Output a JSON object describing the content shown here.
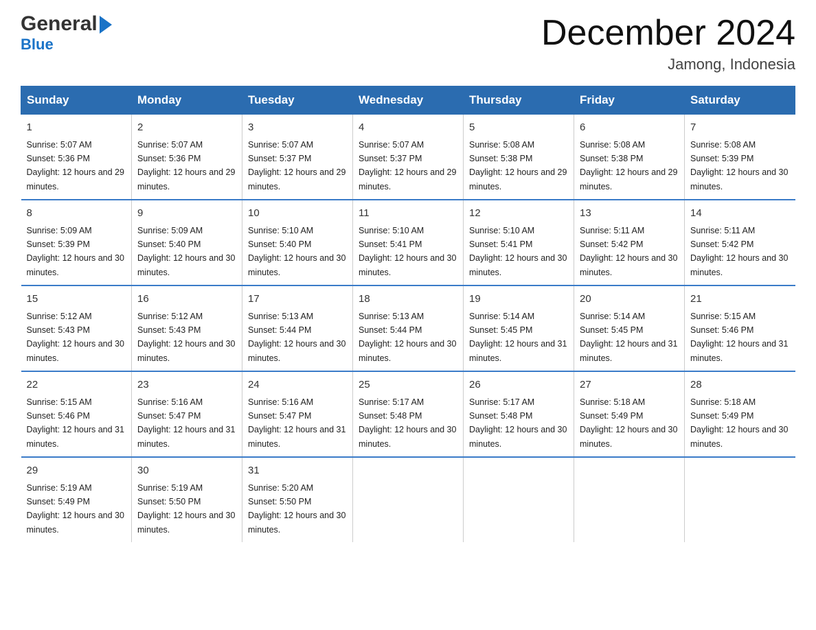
{
  "logo": {
    "general": "General",
    "blue": "Blue",
    "subtitle": "Blue"
  },
  "title": "December 2024",
  "location": "Jamong, Indonesia",
  "days_of_week": [
    "Sunday",
    "Monday",
    "Tuesday",
    "Wednesday",
    "Thursday",
    "Friday",
    "Saturday"
  ],
  "weeks": [
    [
      {
        "day": "1",
        "sunrise": "5:07 AM",
        "sunset": "5:36 PM",
        "daylight": "12 hours and 29 minutes."
      },
      {
        "day": "2",
        "sunrise": "5:07 AM",
        "sunset": "5:36 PM",
        "daylight": "12 hours and 29 minutes."
      },
      {
        "day": "3",
        "sunrise": "5:07 AM",
        "sunset": "5:37 PM",
        "daylight": "12 hours and 29 minutes."
      },
      {
        "day": "4",
        "sunrise": "5:07 AM",
        "sunset": "5:37 PM",
        "daylight": "12 hours and 29 minutes."
      },
      {
        "day": "5",
        "sunrise": "5:08 AM",
        "sunset": "5:38 PM",
        "daylight": "12 hours and 29 minutes."
      },
      {
        "day": "6",
        "sunrise": "5:08 AM",
        "sunset": "5:38 PM",
        "daylight": "12 hours and 29 minutes."
      },
      {
        "day": "7",
        "sunrise": "5:08 AM",
        "sunset": "5:39 PM",
        "daylight": "12 hours and 30 minutes."
      }
    ],
    [
      {
        "day": "8",
        "sunrise": "5:09 AM",
        "sunset": "5:39 PM",
        "daylight": "12 hours and 30 minutes."
      },
      {
        "day": "9",
        "sunrise": "5:09 AM",
        "sunset": "5:40 PM",
        "daylight": "12 hours and 30 minutes."
      },
      {
        "day": "10",
        "sunrise": "5:10 AM",
        "sunset": "5:40 PM",
        "daylight": "12 hours and 30 minutes."
      },
      {
        "day": "11",
        "sunrise": "5:10 AM",
        "sunset": "5:41 PM",
        "daylight": "12 hours and 30 minutes."
      },
      {
        "day": "12",
        "sunrise": "5:10 AM",
        "sunset": "5:41 PM",
        "daylight": "12 hours and 30 minutes."
      },
      {
        "day": "13",
        "sunrise": "5:11 AM",
        "sunset": "5:42 PM",
        "daylight": "12 hours and 30 minutes."
      },
      {
        "day": "14",
        "sunrise": "5:11 AM",
        "sunset": "5:42 PM",
        "daylight": "12 hours and 30 minutes."
      }
    ],
    [
      {
        "day": "15",
        "sunrise": "5:12 AM",
        "sunset": "5:43 PM",
        "daylight": "12 hours and 30 minutes."
      },
      {
        "day": "16",
        "sunrise": "5:12 AM",
        "sunset": "5:43 PM",
        "daylight": "12 hours and 30 minutes."
      },
      {
        "day": "17",
        "sunrise": "5:13 AM",
        "sunset": "5:44 PM",
        "daylight": "12 hours and 30 minutes."
      },
      {
        "day": "18",
        "sunrise": "5:13 AM",
        "sunset": "5:44 PM",
        "daylight": "12 hours and 30 minutes."
      },
      {
        "day": "19",
        "sunrise": "5:14 AM",
        "sunset": "5:45 PM",
        "daylight": "12 hours and 31 minutes."
      },
      {
        "day": "20",
        "sunrise": "5:14 AM",
        "sunset": "5:45 PM",
        "daylight": "12 hours and 31 minutes."
      },
      {
        "day": "21",
        "sunrise": "5:15 AM",
        "sunset": "5:46 PM",
        "daylight": "12 hours and 31 minutes."
      }
    ],
    [
      {
        "day": "22",
        "sunrise": "5:15 AM",
        "sunset": "5:46 PM",
        "daylight": "12 hours and 31 minutes."
      },
      {
        "day": "23",
        "sunrise": "5:16 AM",
        "sunset": "5:47 PM",
        "daylight": "12 hours and 31 minutes."
      },
      {
        "day": "24",
        "sunrise": "5:16 AM",
        "sunset": "5:47 PM",
        "daylight": "12 hours and 31 minutes."
      },
      {
        "day": "25",
        "sunrise": "5:17 AM",
        "sunset": "5:48 PM",
        "daylight": "12 hours and 30 minutes."
      },
      {
        "day": "26",
        "sunrise": "5:17 AM",
        "sunset": "5:48 PM",
        "daylight": "12 hours and 30 minutes."
      },
      {
        "day": "27",
        "sunrise": "5:18 AM",
        "sunset": "5:49 PM",
        "daylight": "12 hours and 30 minutes."
      },
      {
        "day": "28",
        "sunrise": "5:18 AM",
        "sunset": "5:49 PM",
        "daylight": "12 hours and 30 minutes."
      }
    ],
    [
      {
        "day": "29",
        "sunrise": "5:19 AM",
        "sunset": "5:49 PM",
        "daylight": "12 hours and 30 minutes."
      },
      {
        "day": "30",
        "sunrise": "5:19 AM",
        "sunset": "5:50 PM",
        "daylight": "12 hours and 30 minutes."
      },
      {
        "day": "31",
        "sunrise": "5:20 AM",
        "sunset": "5:50 PM",
        "daylight": "12 hours and 30 minutes."
      },
      {
        "day": "",
        "sunrise": "",
        "sunset": "",
        "daylight": ""
      },
      {
        "day": "",
        "sunrise": "",
        "sunset": "",
        "daylight": ""
      },
      {
        "day": "",
        "sunrise": "",
        "sunset": "",
        "daylight": ""
      },
      {
        "day": "",
        "sunrise": "",
        "sunset": "",
        "daylight": ""
      }
    ]
  ],
  "labels": {
    "sunrise": "Sunrise: ",
    "sunset": "Sunset: ",
    "daylight": "Daylight: "
  }
}
